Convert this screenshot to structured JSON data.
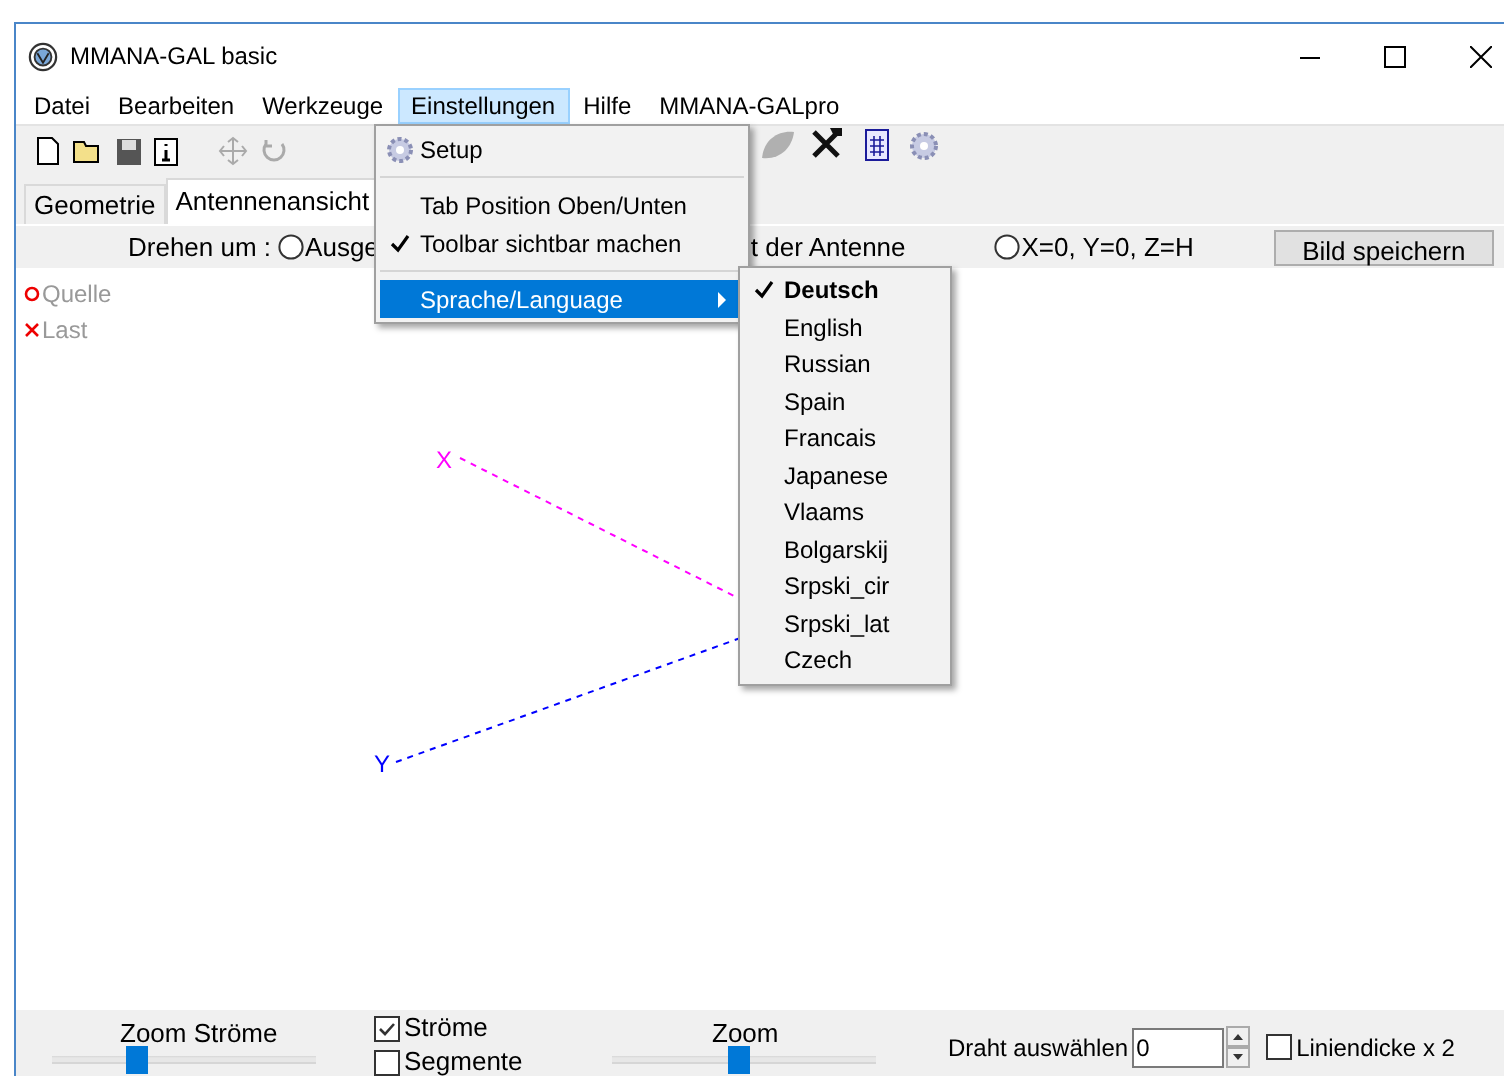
{
  "window": {
    "title": "MMANA-GAL basic"
  },
  "menu_bar": [
    {
      "label": "Datei",
      "selected": false
    },
    {
      "label": "Bearbeiten",
      "selected": false
    },
    {
      "label": "Werkzeuge",
      "selected": false
    },
    {
      "label": "Einstellungen",
      "selected": true
    },
    {
      "label": "Hilfe",
      "selected": false
    },
    {
      "label": "MMANA-GALpro",
      "selected": false
    }
  ],
  "tabs": [
    {
      "label": "Geometrie",
      "selected": false
    },
    {
      "label": "Antennenansicht",
      "selected": true
    }
  ],
  "view_bar": {
    "label": "Drehen um :",
    "option_1": {
      "label": "Ausge",
      "selected": false
    },
    "fragment": "t der Antenne",
    "option_3": {
      "label": "X=0, Y=0, Z=H",
      "selected": false
    },
    "button": "Bild speichern"
  },
  "legend": [
    {
      "kind": "circle",
      "label": "Quelle"
    },
    {
      "kind": "cross",
      "label": "Last"
    }
  ],
  "axes": [
    {
      "label": "X"
    },
    {
      "label": "Y"
    }
  ],
  "menu": [
    {
      "kind": "icon_item",
      "label": "Setup"
    },
    {
      "kind": "separator"
    },
    {
      "kind": "item",
      "label": "Tab Position Oben/Unten",
      "checked": false
    },
    {
      "kind": "item",
      "label": "Toolbar sichtbar machen",
      "checked": true
    },
    {
      "kind": "separator"
    },
    {
      "kind": "submenu",
      "label": "Sprache/Language",
      "selected": true
    }
  ],
  "language_menu": [
    {
      "label": "Deutsch",
      "checked": true
    },
    {
      "label": "English",
      "checked": false
    },
    {
      "label": "Russian",
      "checked": false
    },
    {
      "label": "Spain",
      "checked": false
    },
    {
      "label": "Francais",
      "checked": false
    },
    {
      "label": "Japanese",
      "checked": false
    },
    {
      "label": "Vlaams",
      "checked": false
    },
    {
      "label": "Bolgarskij",
      "checked": false
    },
    {
      "label": "Srpski_cir",
      "checked": false
    },
    {
      "label": "Srpski_lat",
      "checked": false
    },
    {
      "label": "Czech",
      "checked": false
    }
  ],
  "bottom": {
    "zoom_currents": {
      "label": "Zoom Ströme",
      "level": 0.32
    },
    "checks": [
      {
        "label": "Ströme",
        "checked": true
      },
      {
        "label": "Segmente",
        "checked": false
      }
    ],
    "zoom": {
      "label": "Zoom",
      "level": 0.48
    },
    "wire": {
      "label": "Draht auswählen",
      "value": "0"
    },
    "line_width": {
      "label": "Liniendicke x 2",
      "checked": false
    }
  }
}
